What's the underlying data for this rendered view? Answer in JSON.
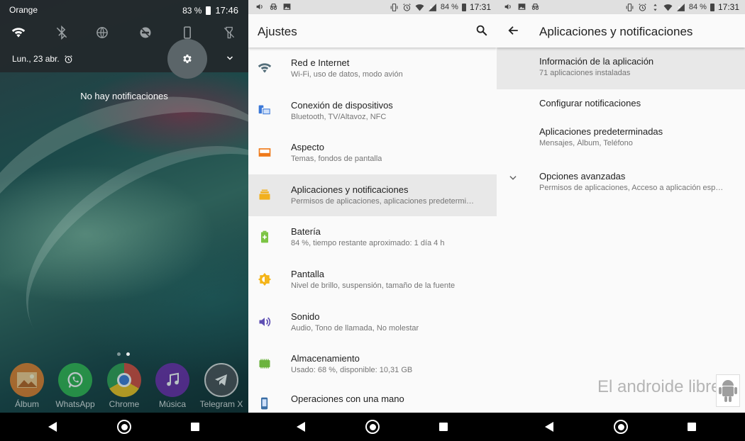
{
  "panel1": {
    "status": {
      "carrier": "Orange",
      "battery": "83 %",
      "time": "17:46"
    },
    "quick_settings": [
      "wifi-icon",
      "bluetooth-off-icon",
      "data-saver-icon",
      "dnd-off-icon",
      "phone-portrait-icon",
      "flashlight-off-icon"
    ],
    "date": "Lun., 23 abr.",
    "no_notifications": "No hay notificaciones",
    "dock": [
      {
        "label": "Álbum",
        "icon": "album-icon",
        "color": "#e07a28"
      },
      {
        "label": "WhatsApp",
        "icon": "whatsapp-icon",
        "color": "#2fb24c"
      },
      {
        "label": "Chrome",
        "icon": "chrome-icon",
        "color": "#d6473a"
      },
      {
        "label": "Música",
        "icon": "music-icon",
        "color": "#6a2aa8"
      },
      {
        "label": "Telegram X",
        "icon": "telegram-icon",
        "color": "#4a4f55"
      }
    ]
  },
  "panel2": {
    "status": {
      "battery": "84 %",
      "time": "17:31"
    },
    "title": "Ajustes",
    "items": [
      {
        "title": "Red e Internet",
        "subtitle": "Wi-Fi, uso de datos, modo avión",
        "icon": "wifi-icon",
        "color": "#546e7a"
      },
      {
        "title": "Conexión de dispositivos",
        "subtitle": "Bluetooth, TV/Altavoz, NFC",
        "icon": "devices-icon",
        "color": "#3b78d8"
      },
      {
        "title": "Aspecto",
        "subtitle": "Temas, fondos de pantalla",
        "icon": "wallpaper-icon",
        "color": "#ef7a1a"
      },
      {
        "title": "Aplicaciones y notificaciones",
        "subtitle": "Permisos de aplicaciones, aplicaciones predetermi…",
        "icon": "apps-icon",
        "color": "#f2b01e"
      },
      {
        "title": "Batería",
        "subtitle": "84 %, tiempo restante aproximado: 1 día 4 h",
        "icon": "battery-icon",
        "color": "#7cc444"
      },
      {
        "title": "Pantalla",
        "subtitle": "Nivel de brillo, suspensión, tamaño de la fuente",
        "icon": "brightness-icon",
        "color": "#f4b418"
      },
      {
        "title": "Sonido",
        "subtitle": "Audio, Tono de llamada, No molestar",
        "icon": "volume-icon",
        "color": "#5e4fb3"
      },
      {
        "title": "Almacenamiento",
        "subtitle": "Usado: 68 %, disponible: 10,31 GB",
        "icon": "storage-icon",
        "color": "#6cb33f"
      },
      {
        "title": "Operaciones con una mano",
        "subtitle": "",
        "icon": "one-hand-icon",
        "color": "#3a6ea5"
      }
    ]
  },
  "panel3": {
    "status": {
      "battery": "84 %",
      "time": "17:31"
    },
    "title": "Aplicaciones y notificaciones",
    "items": [
      {
        "title": "Información de la aplicación",
        "subtitle": "71 aplicaciones instaladas"
      },
      {
        "title": "Configurar notificaciones",
        "subtitle": ""
      },
      {
        "title": "Aplicaciones predeterminadas",
        "subtitle": "Mensajes, Álbum, Teléfono"
      },
      {
        "title": "Opciones avanzadas",
        "subtitle": "Permisos de aplicaciones, Acceso a aplicación esp…"
      }
    ],
    "watermark": "El androide libre"
  }
}
